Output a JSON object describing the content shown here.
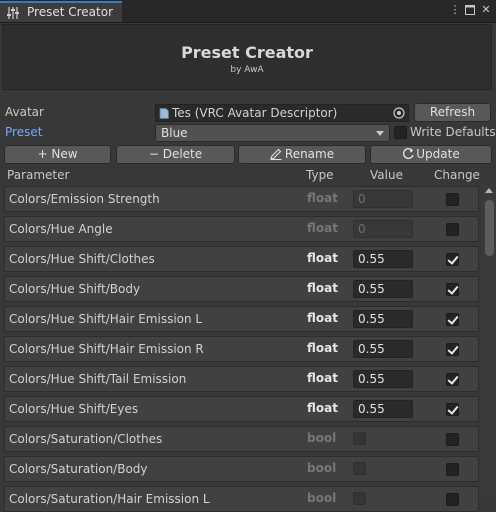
{
  "window": {
    "tab_title": "Preset Creator",
    "tab_icon": "sliders-icon"
  },
  "header": {
    "title": "Preset Creator",
    "subtitle": "by AwA"
  },
  "avatar": {
    "label": "Avatar",
    "value": "Tes (VRC Avatar Descriptor)",
    "refresh_label": "Refresh"
  },
  "preset": {
    "label": "Preset",
    "selected": "Blue",
    "write_defaults_label": "Write Defaults",
    "write_defaults_checked": false
  },
  "actions": {
    "new_label": "+ New",
    "delete_label": "− Delete",
    "rename_label": "Rename",
    "update_label": "Update"
  },
  "columns": {
    "parameter": "Parameter",
    "type": "Type",
    "value": "Value",
    "change": "Change"
  },
  "rows": [
    {
      "name": "Colors/Emission Strength",
      "type": "float",
      "enabled": false,
      "value": "0",
      "change": false
    },
    {
      "name": "Colors/Hue Angle",
      "type": "float",
      "enabled": false,
      "value": "0",
      "change": false
    },
    {
      "name": "Colors/Hue Shift/Clothes",
      "type": "float",
      "enabled": true,
      "value": "0.55",
      "change": true
    },
    {
      "name": "Colors/Hue Shift/Body",
      "type": "float",
      "enabled": true,
      "value": "0.55",
      "change": true
    },
    {
      "name": "Colors/Hue Shift/Hair Emission L",
      "type": "float",
      "enabled": true,
      "value": "0.55",
      "change": true
    },
    {
      "name": "Colors/Hue Shift/Hair Emission R",
      "type": "float",
      "enabled": true,
      "value": "0.55",
      "change": true
    },
    {
      "name": "Colors/Hue Shift/Tail Emission",
      "type": "float",
      "enabled": true,
      "value": "0.55",
      "change": true
    },
    {
      "name": "Colors/Hue Shift/Eyes",
      "type": "float",
      "enabled": true,
      "value": "0.55",
      "change": true
    },
    {
      "name": "Colors/Saturation/Clothes",
      "type": "bool",
      "enabled": false,
      "value": "",
      "change": false
    },
    {
      "name": "Colors/Saturation/Body",
      "type": "bool",
      "enabled": false,
      "value": "",
      "change": false
    },
    {
      "name": "Colors/Saturation/Hair Emission L",
      "type": "bool",
      "enabled": false,
      "value": "",
      "change": false
    }
  ]
}
